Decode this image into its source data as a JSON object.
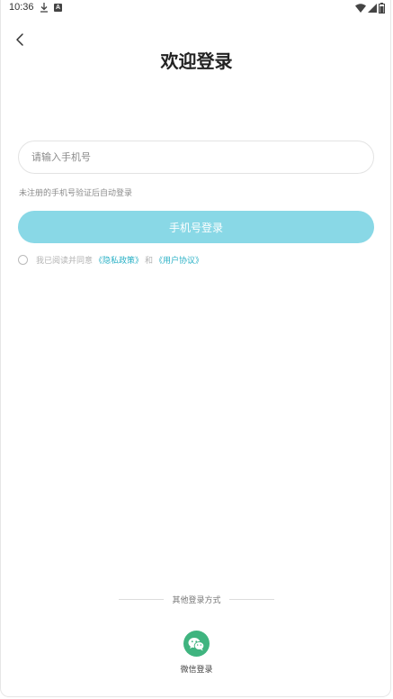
{
  "status_bar": {
    "time": "10:36",
    "icons": [
      "download-icon",
      "notification-a-icon",
      "wifi-icon",
      "signal-icon",
      "battery-icon"
    ]
  },
  "header": {
    "back_icon": "chevron-left-icon",
    "title": "欢迎登录"
  },
  "phone": {
    "placeholder": "请输入手机号",
    "value": ""
  },
  "hint": "未注册的手机号验证后自动登录",
  "login_button": {
    "label": "手机号登录",
    "color": "#89d8e6"
  },
  "agreement": {
    "checked": false,
    "prefix": "我已阅读并同意",
    "privacy_link": "《隐私政策》",
    "and": "和",
    "user_link": "《用户协议》",
    "link_color": "#2bb1c6"
  },
  "other_login": {
    "title": "其他登录方式",
    "wechat_label": "微信登录",
    "wechat_icon": "wechat-icon",
    "wechat_color": "#3fb47f"
  }
}
